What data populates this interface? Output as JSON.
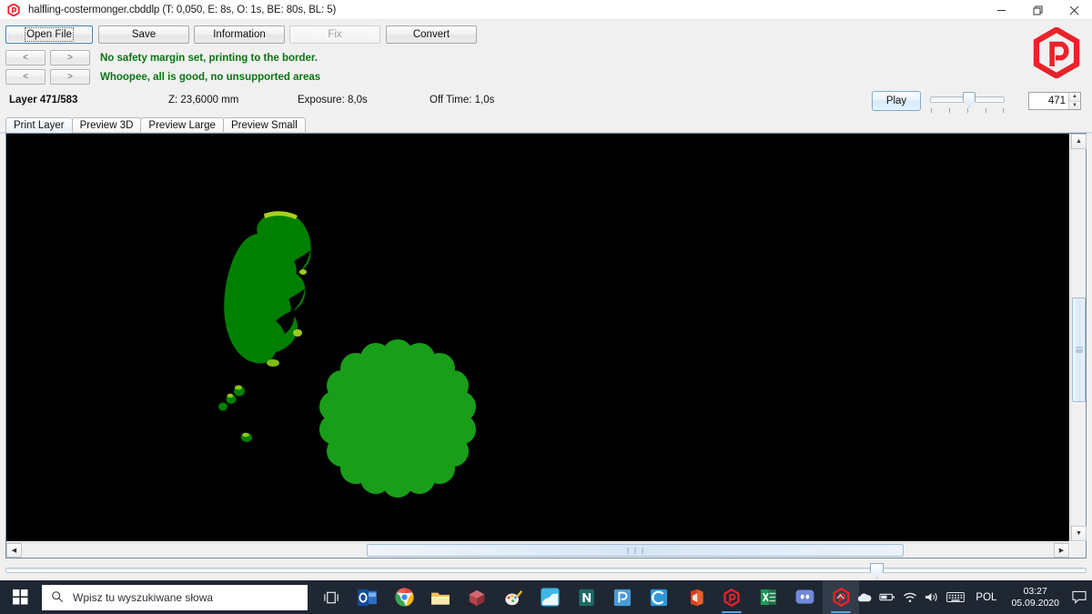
{
  "window": {
    "title": "halfling-costermonger.cbddlp (T: 0,050, E: 8s, O: 1s, BE: 80s, BL: 5)",
    "app_icon": "uvtools-hex-p-icon",
    "minimize_label": "—",
    "restore_label": "❐",
    "close_label": "✕"
  },
  "toolbar": {
    "open_file": "Open File",
    "save": "Save",
    "information": "Information",
    "fix": "Fix",
    "convert": "Convert"
  },
  "nav": {
    "prev": "<",
    "next": ">",
    "prev2": "<",
    "next2": ">"
  },
  "messages": {
    "line1": "No safety margin set, printing to the border.",
    "line2": "Whoopee, all is good, no unsupported areas",
    "color": "#0a7512"
  },
  "info": {
    "layer": "Layer 471/583",
    "z": "Z: 23,6000 mm",
    "exposure": "Exposure: 8,0s",
    "off_time": "Off Time: 1,0s"
  },
  "playback": {
    "play_label": "Play",
    "layer_value": "471",
    "slider_ticks": 5,
    "spin_up": "▲",
    "spin_down": "▼"
  },
  "tabs": [
    {
      "label": "Print Layer",
      "active": true
    },
    {
      "label": "Preview 3D",
      "active": false
    },
    {
      "label": "Preview Large",
      "active": false
    },
    {
      "label": "Preview Small",
      "active": false
    }
  ],
  "canvas": {
    "background": "#000000",
    "shape_color": "#008000",
    "highlight_color": "#9ad01a",
    "scroll_up": "▲",
    "scroll_down": "▼",
    "scroll_left": "◄",
    "scroll_right": "►"
  },
  "taskbar": {
    "start_label": "start-button",
    "search_placeholder": "Wpisz tu wyszukiwane słowa",
    "apps": [
      {
        "name": "task-view",
        "glyph": "taskview"
      },
      {
        "name": "outlook",
        "glyph": "outlook"
      },
      {
        "name": "chrome",
        "glyph": "chrome"
      },
      {
        "name": "file-explorer",
        "glyph": "explorer"
      },
      {
        "name": "3d-builder",
        "glyph": "builder"
      },
      {
        "name": "paint-3d",
        "glyph": "paint3d"
      },
      {
        "name": "photos",
        "glyph": "photos"
      },
      {
        "name": "onenote",
        "glyph": "onenote"
      },
      {
        "name": "prusaslicer",
        "glyph": "pblue"
      },
      {
        "name": "chitubox",
        "glyph": "cblue"
      },
      {
        "name": "office",
        "glyph": "office"
      },
      {
        "name": "uvtools",
        "glyph": "uvtools"
      },
      {
        "name": "excel",
        "glyph": "excel"
      },
      {
        "name": "discord",
        "glyph": "discord"
      },
      {
        "name": "uvtools-active",
        "glyph": "uvtools"
      }
    ],
    "tray": {
      "chevron": "∧",
      "onedrive": "onedrive-icon",
      "battery": "battery-icon",
      "wifi": "wifi-icon",
      "volume": "volume-icon",
      "keyboard": "keyboard-icon",
      "language": "POL",
      "time": "03:27",
      "date": "05.09.2020",
      "notifications": "notification-icon"
    }
  }
}
